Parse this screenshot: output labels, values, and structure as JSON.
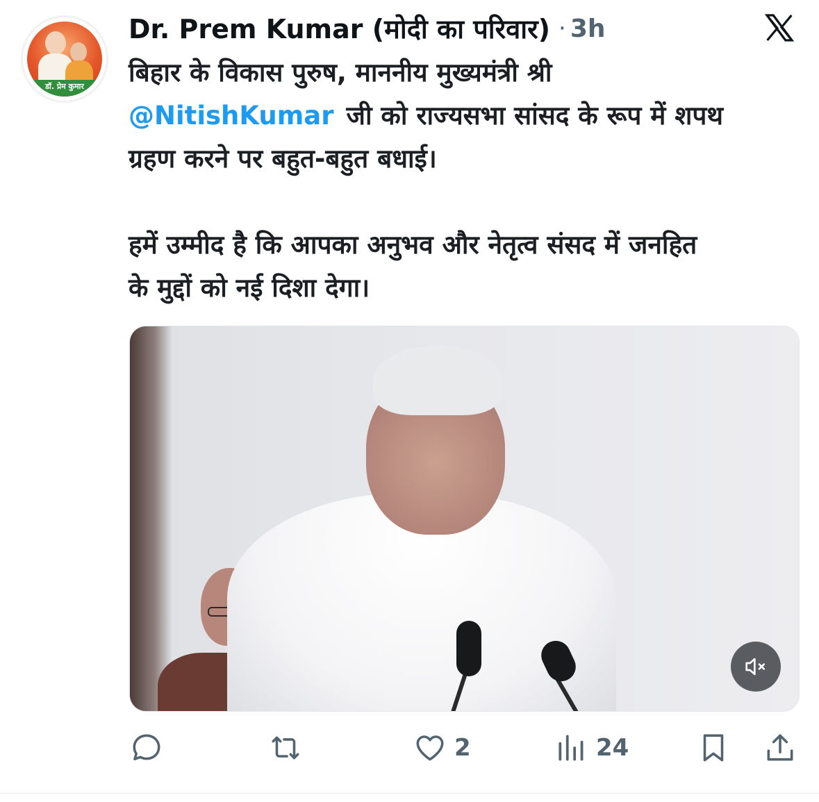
{
  "author": {
    "display_name": "Dr. Prem Kumar (मोदी का परिवार)",
    "avatar_badge_text": "डॉ. प्रेम कुमार",
    "time_sep": "·",
    "timestamp": "3h"
  },
  "tweet": {
    "line1": "बिहार के विकास पुरुष, माननीय मुख्यमंत्री श्री",
    "mention": "@NitishKumar",
    "line2_after_mention": "जी को राज्यसभा सांसद के रूप में शपथ",
    "line3": "ग्रहण करने पर बहुत-बहुत बधाई।",
    "para2_line1": "हमें उम्मीद है कि आपका अनुभव और नेतृत्व संसद में जनहित",
    "para2_line2": "के मुद्दों को नई दिशा देगा।"
  },
  "media": {
    "type": "video",
    "mute_icon": "speaker-muted-icon"
  },
  "actions": {
    "reply": {
      "icon": "reply-icon",
      "count": ""
    },
    "retweet": {
      "icon": "retweet-icon",
      "count": ""
    },
    "like": {
      "icon": "heart-icon",
      "count": "2"
    },
    "views": {
      "icon": "views-chart-icon",
      "count": "24"
    },
    "bookmark": {
      "icon": "bookmark-icon"
    },
    "share": {
      "icon": "share-icon"
    }
  },
  "colors": {
    "text": "#0f1419",
    "secondary": "#536471",
    "link": "#1d9bf0"
  }
}
